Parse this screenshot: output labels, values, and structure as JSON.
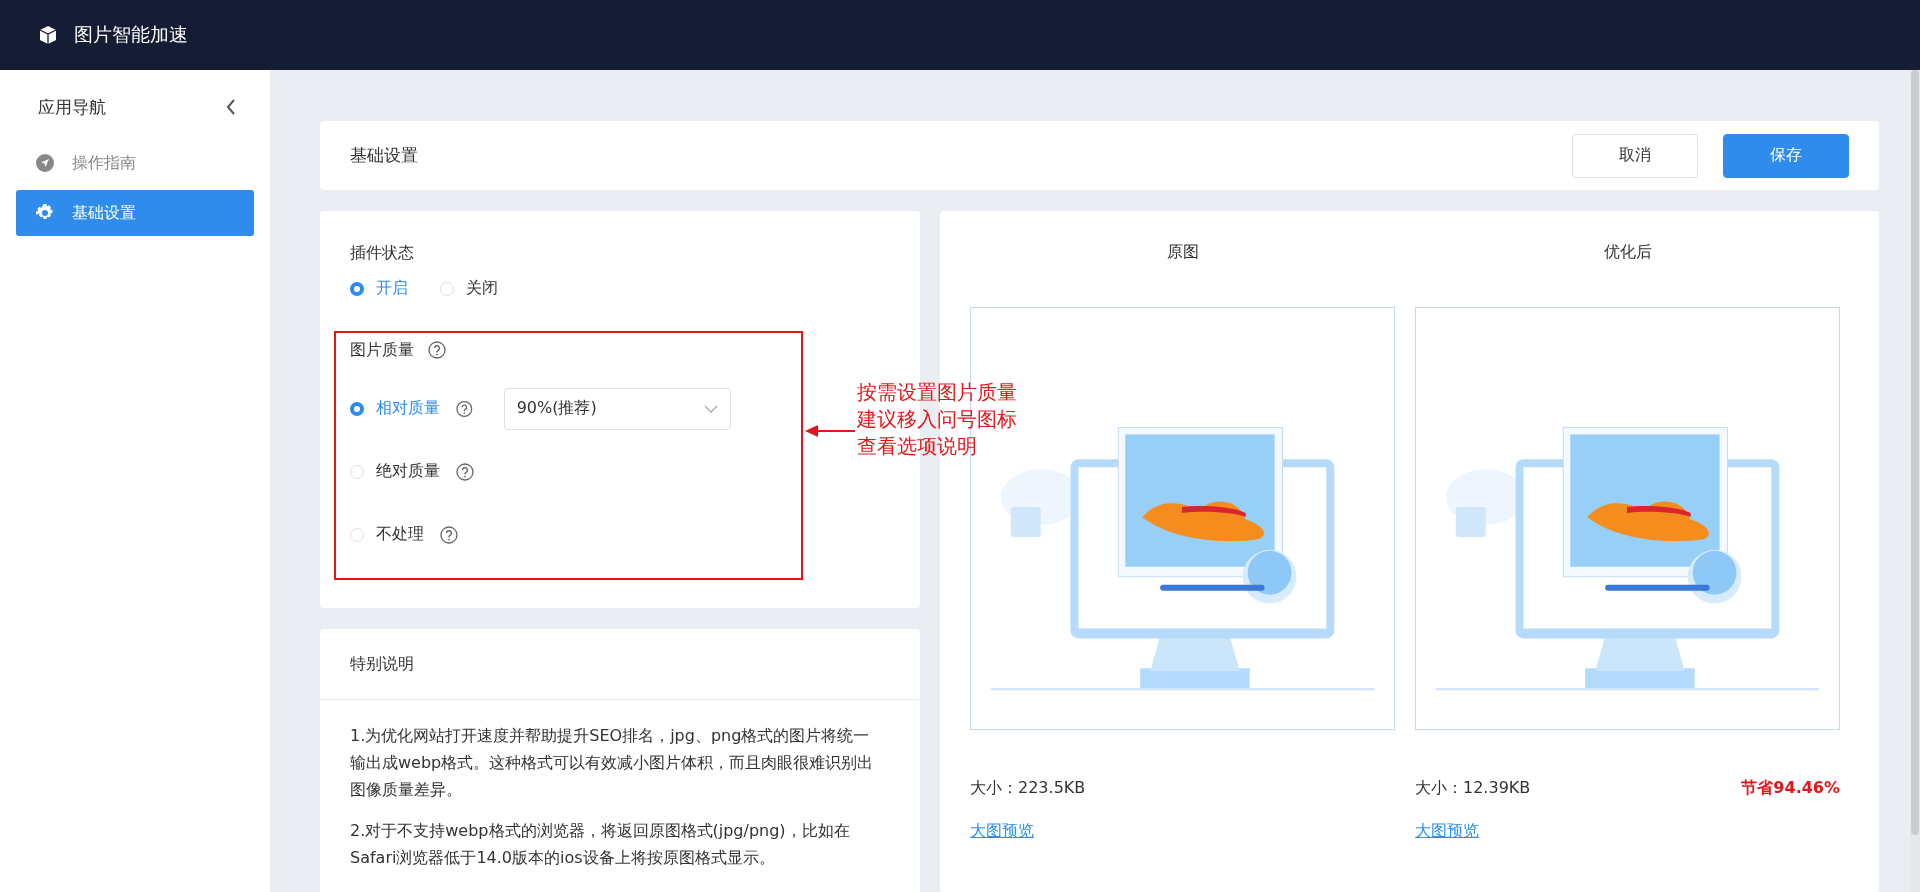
{
  "app_bar": {
    "title": "图片智能加速"
  },
  "sidebar": {
    "title": "应用导航",
    "items": [
      {
        "label": "操作指南",
        "selected": false
      },
      {
        "label": "基础设置",
        "selected": true
      }
    ]
  },
  "header": {
    "title": "基础设置",
    "buttons": [
      {
        "label": "取消",
        "kind": "default"
      },
      {
        "label": "保存",
        "kind": "primary"
      }
    ]
  },
  "plugin_status": {
    "label": "插件状态",
    "options": [
      {
        "label": "开启",
        "selected": true
      },
      {
        "label": "关闭",
        "selected": false
      }
    ]
  },
  "image_quality": {
    "label": "图片质量",
    "options": [
      {
        "label": "相对质量",
        "selected": true,
        "select_value": "90%(推荐)"
      },
      {
        "label": "绝对质量",
        "selected": false
      },
      {
        "label": "不处理",
        "selected": false
      }
    ]
  },
  "annotation": {
    "lines": [
      "按需设置图片质量",
      "建议移入问号图标",
      "查看选项说明"
    ]
  },
  "notes": {
    "title": "特别说明",
    "paragraphs": [
      "1.为优化网站打开速度并帮助提升SEO排名，jpg、png格式的图片将统一输出成webp格式。这种格式可以有效减小图片体积，而且肉眼很难识别出图像质量差异。",
      "2.对于不支持webp格式的浏览器，将返回原图格式(jpg/png)，比如在Safari浏览器低于14.0版本的ios设备上将按原图格式显示。"
    ]
  },
  "comparison": [
    {
      "title": "原图",
      "size": "大小：223.5KB",
      "link": "大图预览"
    },
    {
      "title": "优化后",
      "size": "大小：12.39KB",
      "saving": "节省94.46%",
      "link": "大图预览"
    }
  ]
}
